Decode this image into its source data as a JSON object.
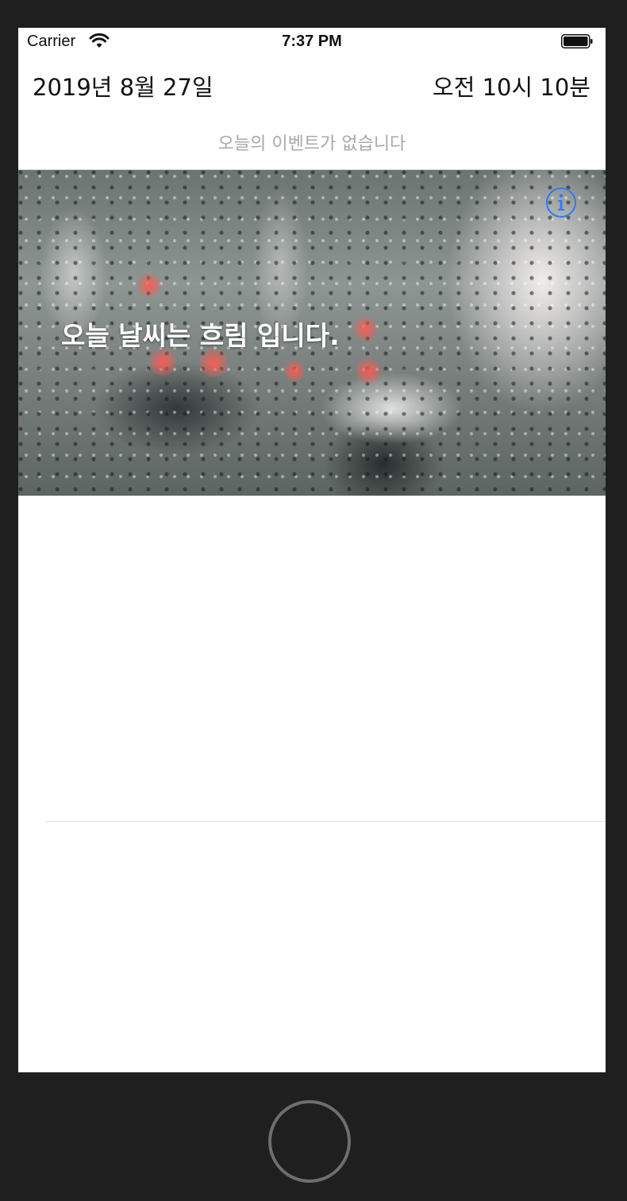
{
  "status_bar": {
    "carrier": "Carrier",
    "time": "7:37 PM"
  },
  "header": {
    "date": "2019년 8월 27일",
    "time": "오전 10시 10분"
  },
  "events": {
    "empty_message": "오늘의 이벤트가 없습니다"
  },
  "weather": {
    "message": "오늘 날씨는 흐림 입니다.",
    "info_icon": "info-icon"
  },
  "colors": {
    "accent": "#3478f6",
    "placeholder_text": "#a9a9a9",
    "device_frame": "#1f1f1f"
  }
}
